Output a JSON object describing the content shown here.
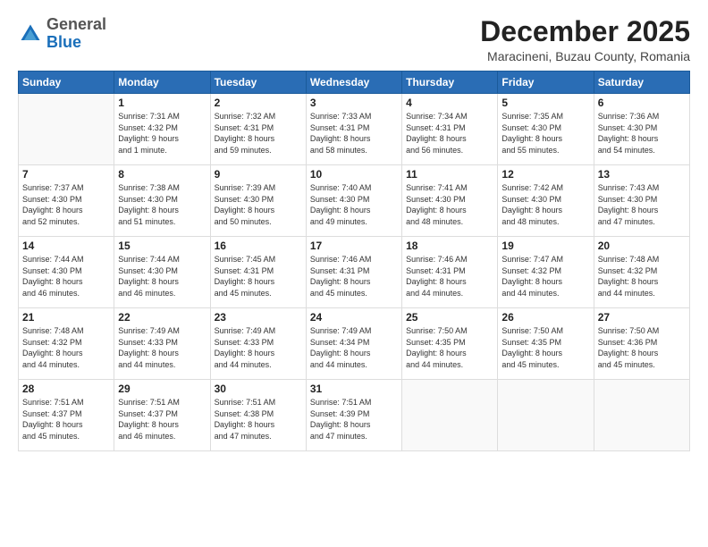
{
  "header": {
    "logo_general": "General",
    "logo_blue": "Blue",
    "month_year": "December 2025",
    "location": "Maracineni, Buzau County, Romania"
  },
  "days_of_week": [
    "Sunday",
    "Monday",
    "Tuesday",
    "Wednesday",
    "Thursday",
    "Friday",
    "Saturday"
  ],
  "weeks": [
    [
      {
        "day": "",
        "info": ""
      },
      {
        "day": "1",
        "info": "Sunrise: 7:31 AM\nSunset: 4:32 PM\nDaylight: 9 hours\nand 1 minute."
      },
      {
        "day": "2",
        "info": "Sunrise: 7:32 AM\nSunset: 4:31 PM\nDaylight: 8 hours\nand 59 minutes."
      },
      {
        "day": "3",
        "info": "Sunrise: 7:33 AM\nSunset: 4:31 PM\nDaylight: 8 hours\nand 58 minutes."
      },
      {
        "day": "4",
        "info": "Sunrise: 7:34 AM\nSunset: 4:31 PM\nDaylight: 8 hours\nand 56 minutes."
      },
      {
        "day": "5",
        "info": "Sunrise: 7:35 AM\nSunset: 4:30 PM\nDaylight: 8 hours\nand 55 minutes."
      },
      {
        "day": "6",
        "info": "Sunrise: 7:36 AM\nSunset: 4:30 PM\nDaylight: 8 hours\nand 54 minutes."
      }
    ],
    [
      {
        "day": "7",
        "info": "Sunrise: 7:37 AM\nSunset: 4:30 PM\nDaylight: 8 hours\nand 52 minutes."
      },
      {
        "day": "8",
        "info": "Sunrise: 7:38 AM\nSunset: 4:30 PM\nDaylight: 8 hours\nand 51 minutes."
      },
      {
        "day": "9",
        "info": "Sunrise: 7:39 AM\nSunset: 4:30 PM\nDaylight: 8 hours\nand 50 minutes."
      },
      {
        "day": "10",
        "info": "Sunrise: 7:40 AM\nSunset: 4:30 PM\nDaylight: 8 hours\nand 49 minutes."
      },
      {
        "day": "11",
        "info": "Sunrise: 7:41 AM\nSunset: 4:30 PM\nDaylight: 8 hours\nand 48 minutes."
      },
      {
        "day": "12",
        "info": "Sunrise: 7:42 AM\nSunset: 4:30 PM\nDaylight: 8 hours\nand 48 minutes."
      },
      {
        "day": "13",
        "info": "Sunrise: 7:43 AM\nSunset: 4:30 PM\nDaylight: 8 hours\nand 47 minutes."
      }
    ],
    [
      {
        "day": "14",
        "info": "Sunrise: 7:44 AM\nSunset: 4:30 PM\nDaylight: 8 hours\nand 46 minutes."
      },
      {
        "day": "15",
        "info": "Sunrise: 7:44 AM\nSunset: 4:30 PM\nDaylight: 8 hours\nand 46 minutes."
      },
      {
        "day": "16",
        "info": "Sunrise: 7:45 AM\nSunset: 4:31 PM\nDaylight: 8 hours\nand 45 minutes."
      },
      {
        "day": "17",
        "info": "Sunrise: 7:46 AM\nSunset: 4:31 PM\nDaylight: 8 hours\nand 45 minutes."
      },
      {
        "day": "18",
        "info": "Sunrise: 7:46 AM\nSunset: 4:31 PM\nDaylight: 8 hours\nand 44 minutes."
      },
      {
        "day": "19",
        "info": "Sunrise: 7:47 AM\nSunset: 4:32 PM\nDaylight: 8 hours\nand 44 minutes."
      },
      {
        "day": "20",
        "info": "Sunrise: 7:48 AM\nSunset: 4:32 PM\nDaylight: 8 hours\nand 44 minutes."
      }
    ],
    [
      {
        "day": "21",
        "info": "Sunrise: 7:48 AM\nSunset: 4:32 PM\nDaylight: 8 hours\nand 44 minutes."
      },
      {
        "day": "22",
        "info": "Sunrise: 7:49 AM\nSunset: 4:33 PM\nDaylight: 8 hours\nand 44 minutes."
      },
      {
        "day": "23",
        "info": "Sunrise: 7:49 AM\nSunset: 4:33 PM\nDaylight: 8 hours\nand 44 minutes."
      },
      {
        "day": "24",
        "info": "Sunrise: 7:49 AM\nSunset: 4:34 PM\nDaylight: 8 hours\nand 44 minutes."
      },
      {
        "day": "25",
        "info": "Sunrise: 7:50 AM\nSunset: 4:35 PM\nDaylight: 8 hours\nand 44 minutes."
      },
      {
        "day": "26",
        "info": "Sunrise: 7:50 AM\nSunset: 4:35 PM\nDaylight: 8 hours\nand 45 minutes."
      },
      {
        "day": "27",
        "info": "Sunrise: 7:50 AM\nSunset: 4:36 PM\nDaylight: 8 hours\nand 45 minutes."
      }
    ],
    [
      {
        "day": "28",
        "info": "Sunrise: 7:51 AM\nSunset: 4:37 PM\nDaylight: 8 hours\nand 45 minutes."
      },
      {
        "day": "29",
        "info": "Sunrise: 7:51 AM\nSunset: 4:37 PM\nDaylight: 8 hours\nand 46 minutes."
      },
      {
        "day": "30",
        "info": "Sunrise: 7:51 AM\nSunset: 4:38 PM\nDaylight: 8 hours\nand 47 minutes."
      },
      {
        "day": "31",
        "info": "Sunrise: 7:51 AM\nSunset: 4:39 PM\nDaylight: 8 hours\nand 47 minutes."
      },
      {
        "day": "",
        "info": ""
      },
      {
        "day": "",
        "info": ""
      },
      {
        "day": "",
        "info": ""
      }
    ]
  ]
}
